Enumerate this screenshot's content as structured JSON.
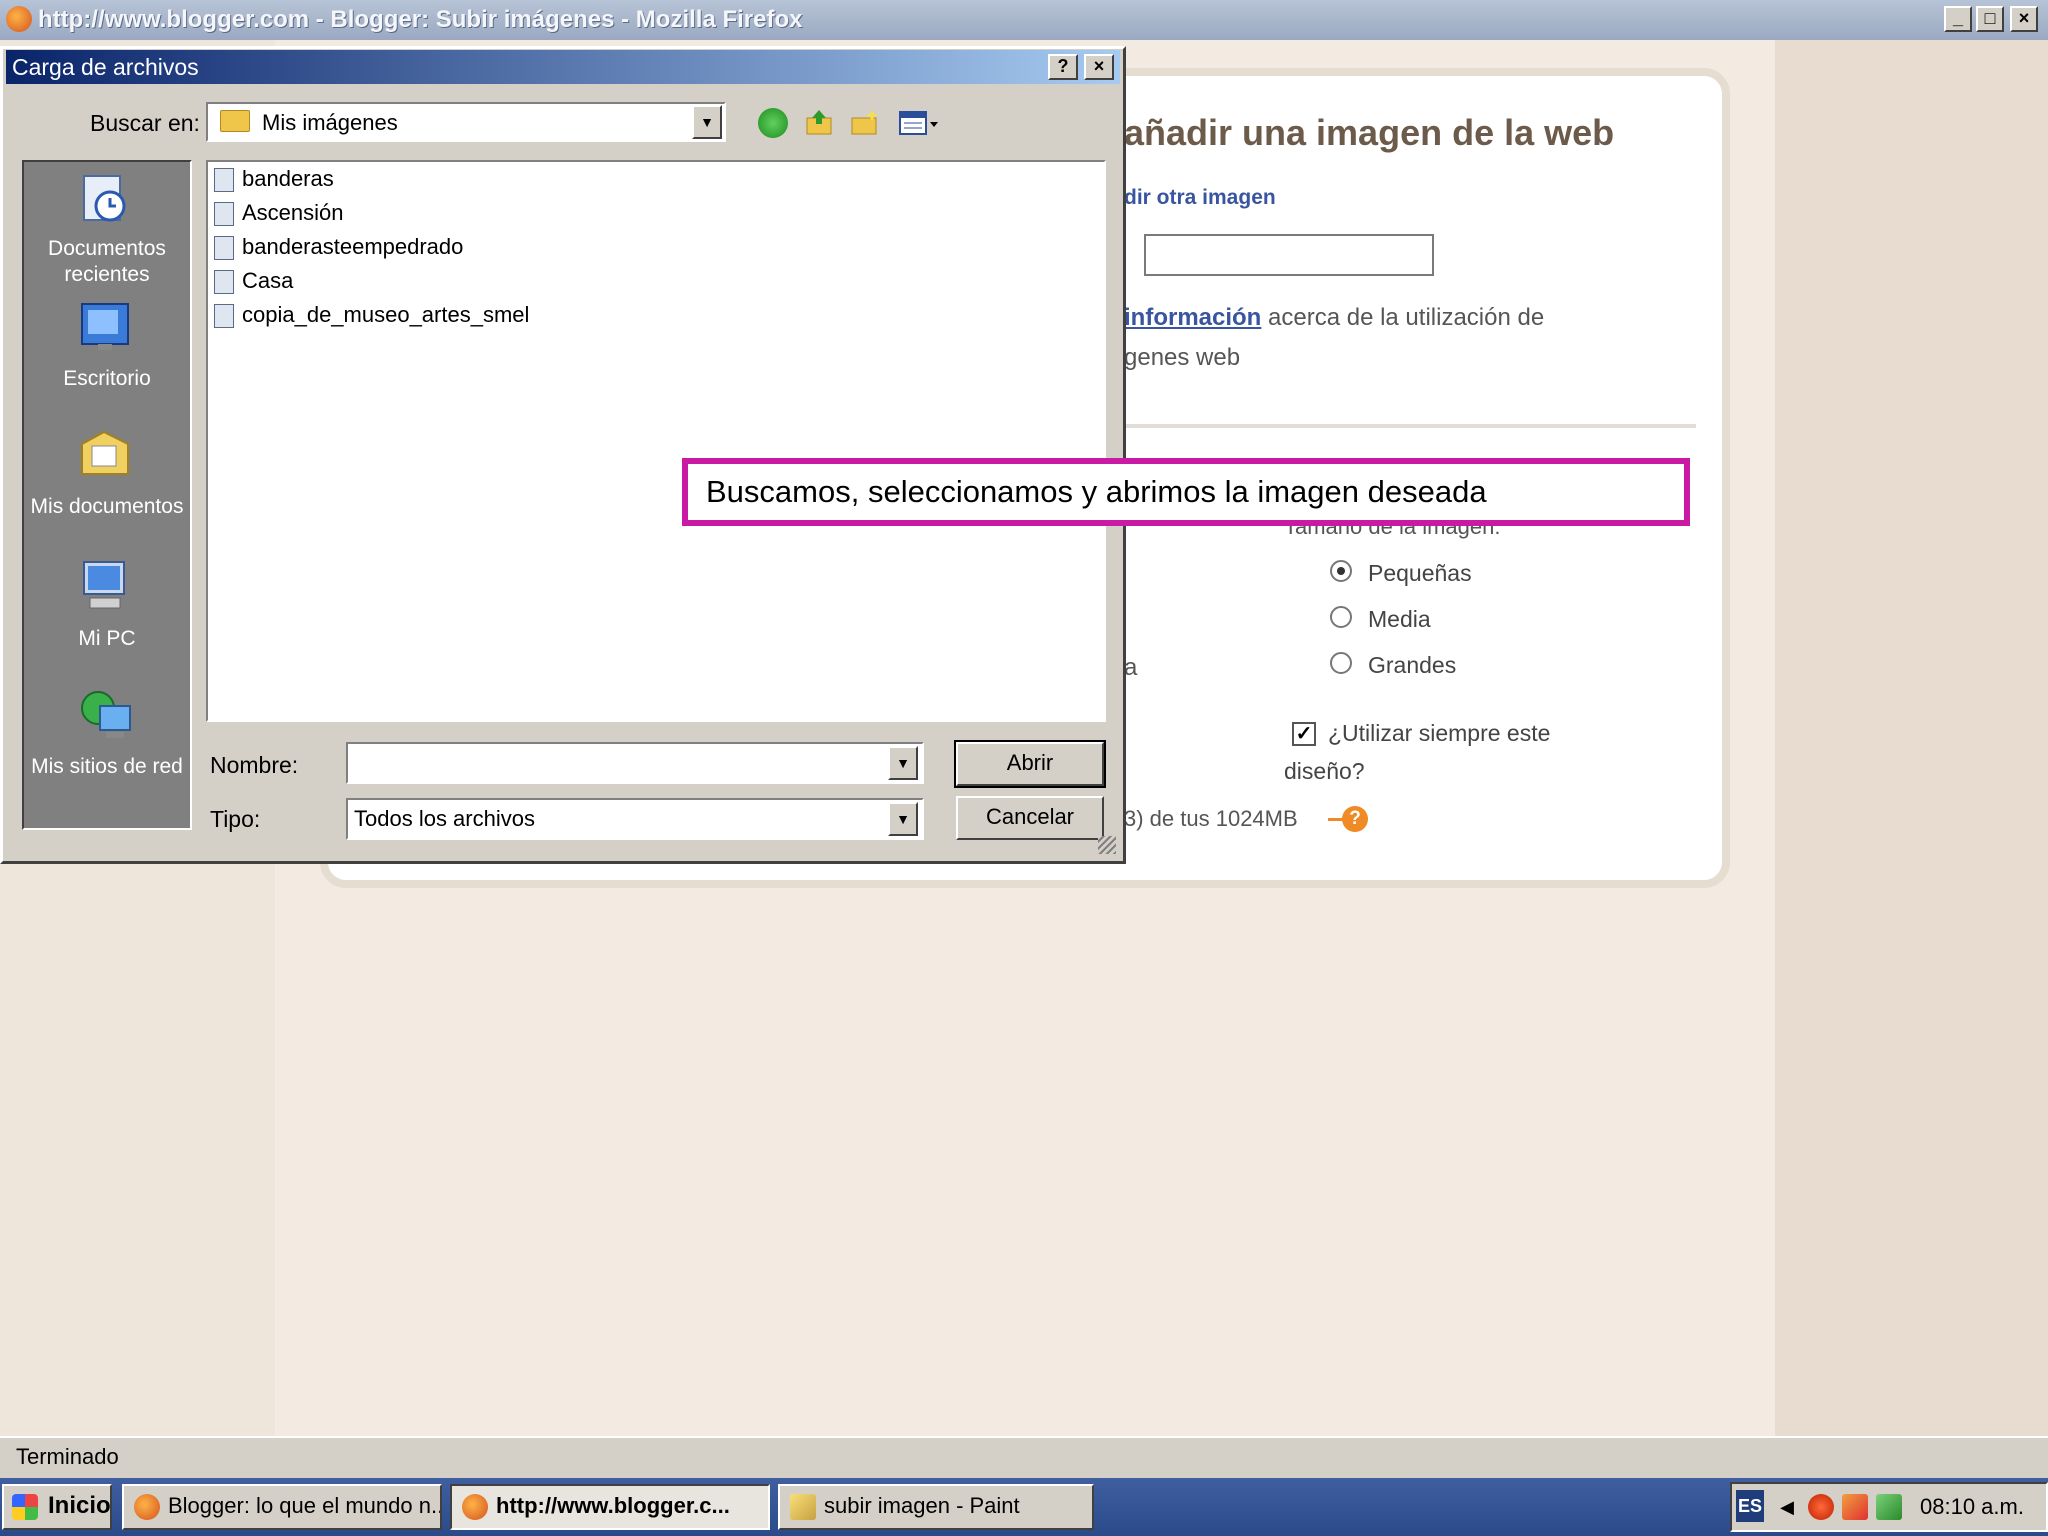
{
  "firefox": {
    "title": "http://www.blogger.com - Blogger: Subir imágenes - Mozilla Firefox",
    "controls": {
      "minimize": "_",
      "maximize": "□",
      "close": "×"
    }
  },
  "blogger": {
    "heading": "añadir una imagen de la web",
    "add_other_link": "dir otra imagen",
    "url_input_value": "",
    "info_link": "información",
    "info_text": " acerca de la utilización de",
    "info_text2": "genes web",
    "size_label": "Tamaño de la imagen:",
    "sizes": [
      {
        "label": "Pequeñas",
        "selected": true
      },
      {
        "label": "Media",
        "selected": false
      },
      {
        "label": "Grandes",
        "selected": false
      }
    ],
    "partial_a": "a",
    "always_checked": true,
    "always_text": "¿Utilizar siempre este",
    "always_text2": "diseño?",
    "quota_text": "3) de tus 1024MB"
  },
  "dialog": {
    "title": "Carga de archivos",
    "help_btn": "?",
    "close_btn": "×",
    "lookin_label": "Buscar en:",
    "lookin_value": "Mis imágenes",
    "places": [
      {
        "label": "Documentos recientes",
        "icon": "recent-documents-icon"
      },
      {
        "label": "Escritorio",
        "icon": "desktop-icon"
      },
      {
        "label": "Mis documentos",
        "icon": "my-documents-icon"
      },
      {
        "label": "Mi PC",
        "icon": "my-computer-icon"
      },
      {
        "label": "Mis sitios de red",
        "icon": "network-places-icon"
      }
    ],
    "files": [
      "banderas",
      "Ascensión",
      "banderasteempedrado",
      "Casa",
      "copia_de_museo_artes_smel"
    ],
    "name_label": "Nombre:",
    "name_value": "",
    "type_label": "Tipo:",
    "type_value": "Todos los archivos",
    "open_btn": "Abrir",
    "cancel_btn": "Cancelar"
  },
  "annotation": {
    "text": "Buscamos, seleccionamos y abrimos la imagen deseada",
    "border_color": "#c91aa6"
  },
  "statusbar": {
    "text": "Terminado"
  },
  "taskbar": {
    "start": "Inicio",
    "tasks": [
      {
        "label": "Blogger: lo que el mundo n...",
        "active": false
      },
      {
        "label": "http://www.blogger.c...",
        "active": true
      },
      {
        "label": "subir imagen - Paint",
        "active": false
      }
    ],
    "lang": "ES",
    "clock": "08:10 a.m."
  }
}
